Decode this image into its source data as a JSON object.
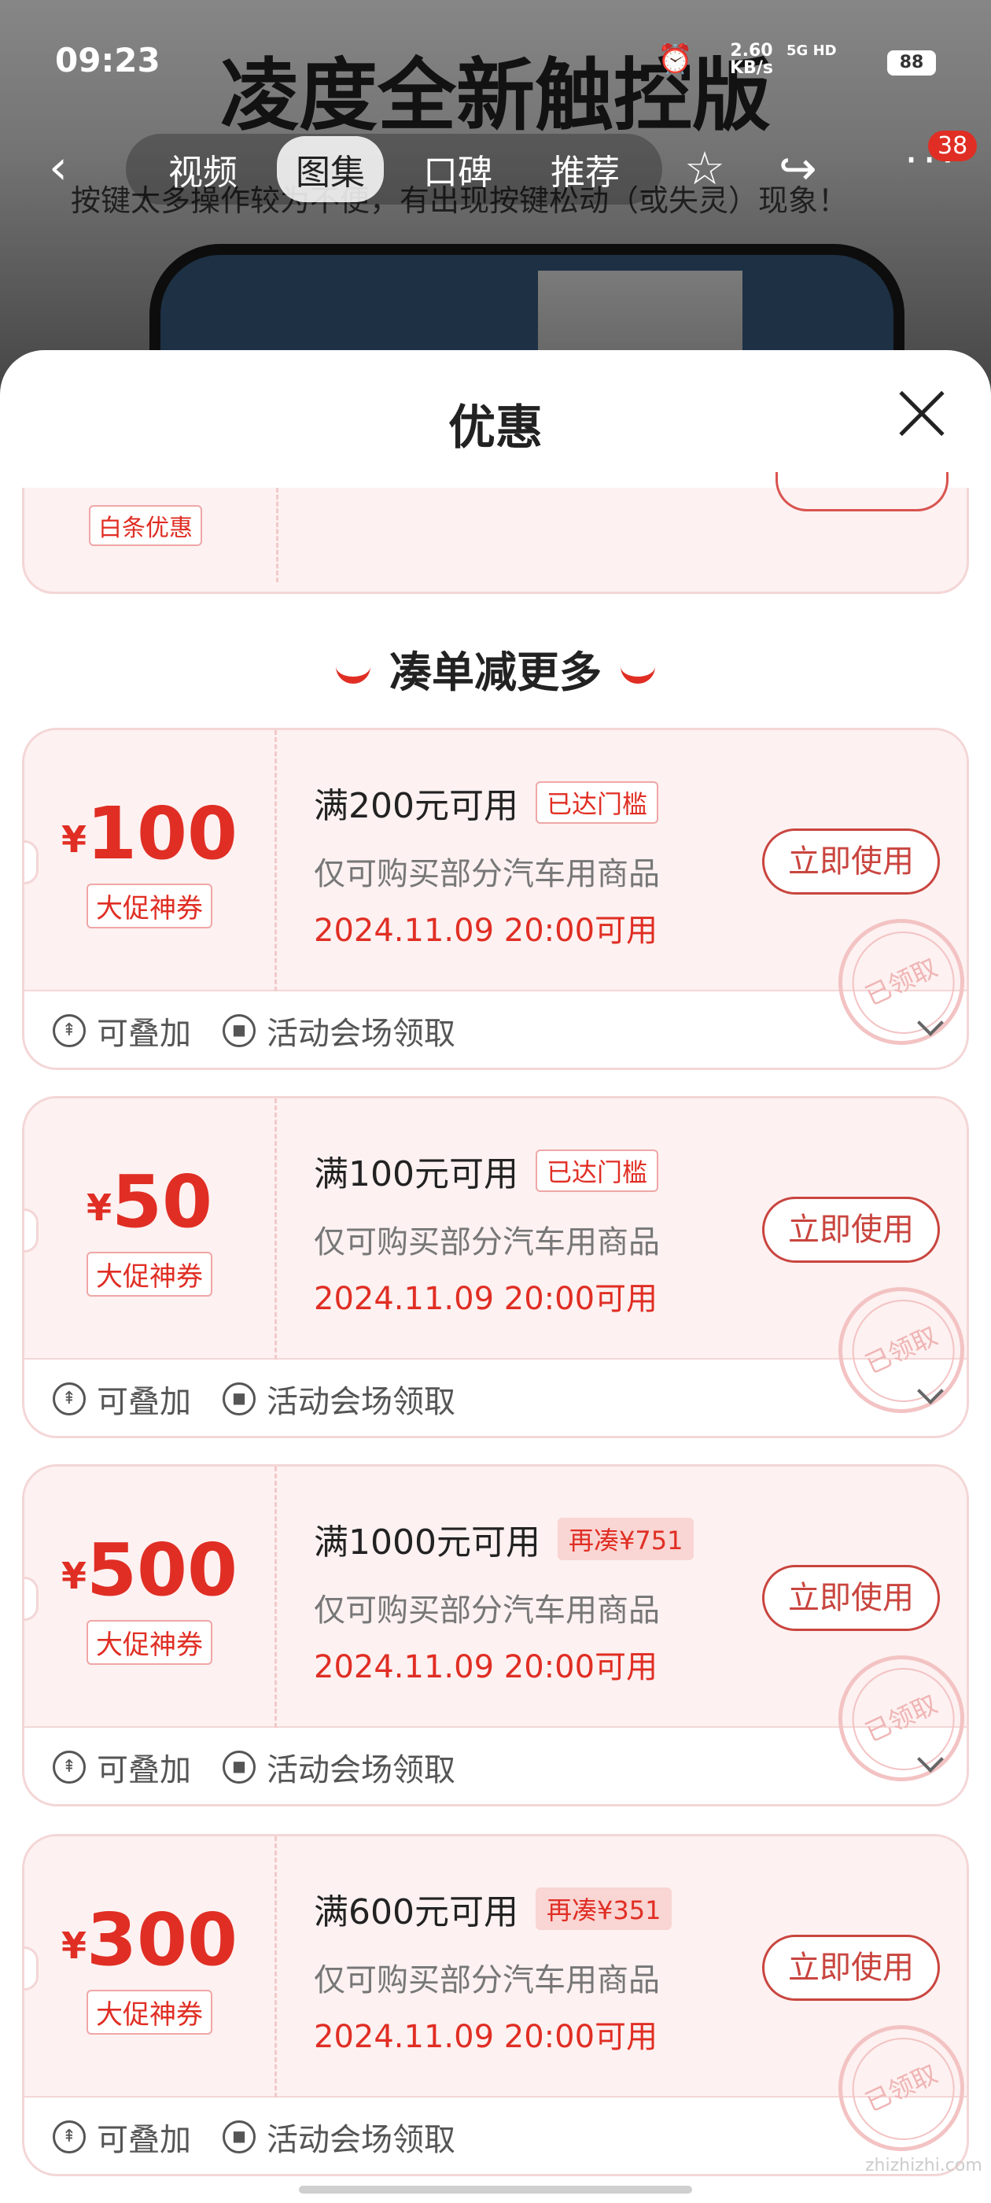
{
  "status_bar": {
    "time": "09:23",
    "speed_value": "2.60",
    "speed_unit": "KB/s",
    "network": "5G HD",
    "battery": "88"
  },
  "background": {
    "headline": "凌度全新触控版",
    "subline": "按键太多操作较为不便，有出现按键松动（或失灵）现象！"
  },
  "nav": {
    "tabs": [
      {
        "label": "视频",
        "active": false
      },
      {
        "label": "图集",
        "active": true
      },
      {
        "label": "口碑",
        "active": false
      },
      {
        "label": "推荐",
        "active": false
      }
    ],
    "more_badge": "38"
  },
  "sheet": {
    "title": "优惠",
    "prev_coupon_tag": "白条优惠",
    "section_title": "凑单减更多"
  },
  "coupons": [
    {
      "currency": "¥",
      "amount": "100",
      "tag": "大促神券",
      "condition": "满200元可用",
      "badge": "已达门槛",
      "badge_style": "outline",
      "scope": "仅可购买部分汽车用商品",
      "time": "2024.11.09 20:00可用",
      "button": "立即使用",
      "stamp": "已领取",
      "stackable": "可叠加",
      "source": "活动会场领取"
    },
    {
      "currency": "¥",
      "amount": "50",
      "tag": "大促神券",
      "condition": "满100元可用",
      "badge": "已达门槛",
      "badge_style": "outline",
      "scope": "仅可购买部分汽车用商品",
      "time": "2024.11.09 20:00可用",
      "button": "立即使用",
      "stamp": "已领取",
      "stackable": "可叠加",
      "source": "活动会场领取"
    },
    {
      "currency": "¥",
      "amount": "500",
      "tag": "大促神券",
      "condition": "满1000元可用",
      "badge": "再凑¥751",
      "badge_style": "fill",
      "scope": "仅可购买部分汽车用商品",
      "time": "2024.11.09 20:00可用",
      "button": "立即使用",
      "stamp": "已领取",
      "stackable": "可叠加",
      "source": "活动会场领取"
    },
    {
      "currency": "¥",
      "amount": "300",
      "tag": "大促神券",
      "condition": "满600元可用",
      "badge": "再凑¥351",
      "badge_style": "fill",
      "scope": "仅可购买部分汽车用商品",
      "time": "2024.11.09 20:00可用",
      "button": "立即使用",
      "stamp": "已领取",
      "stackable": "可叠加",
      "source": "活动会场领取"
    }
  ],
  "watermark": "zhizhizhi.com",
  "colors": {
    "accent": "#e02e24",
    "card_bg": "#fdf1f1",
    "card_border": "#f4d6d6"
  }
}
